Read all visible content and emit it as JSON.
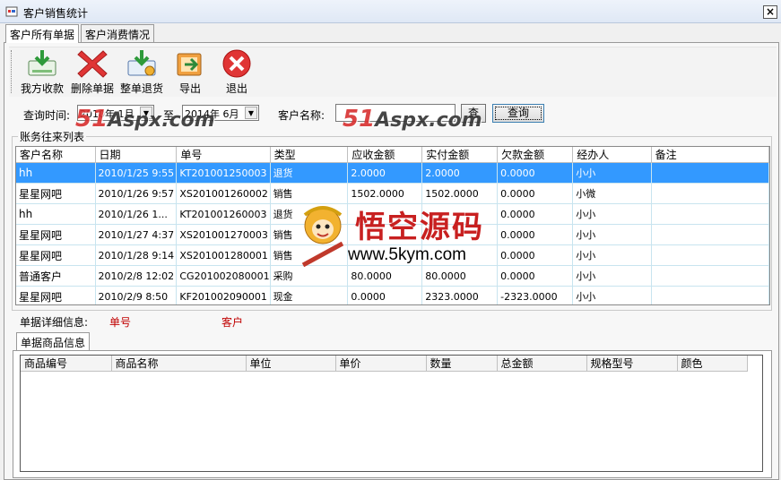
{
  "window": {
    "title": "客户销售统计",
    "close": "×"
  },
  "tabs": [
    "客户所有单据",
    "客户消费情况"
  ],
  "toolbar": {
    "buttons": [
      {
        "label": "我方收款",
        "icon": "money-receive-icon"
      },
      {
        "label": "删除单据",
        "icon": "delete-x-icon"
      },
      {
        "label": "整单退货",
        "icon": "return-goods-icon"
      },
      {
        "label": "导出",
        "icon": "export-icon"
      },
      {
        "label": "退出",
        "icon": "exit-icon"
      }
    ]
  },
  "query": {
    "time_label": "查询时间:",
    "from": "2010年 1月",
    "to_label": "至",
    "to": "2014年 6月",
    "customer_label": "客户名称:",
    "customer_value": "",
    "lookup_button": "查",
    "search_button": "查询"
  },
  "ledger": {
    "group_label": "账务往来列表",
    "columns": [
      "客户名称",
      "日期",
      "单号",
      "类型",
      "应收金额",
      "实付金额",
      "欠款金额",
      "经办人",
      "备注"
    ],
    "rows": [
      [
        "hh",
        "2010/1/25 9:55",
        "KT201001250003",
        "退货",
        "2.0000",
        "2.0000",
        "0.0000",
        "小小",
        ""
      ],
      [
        "星星网吧",
        "2010/1/26 9:57",
        "XS201001260002",
        "销售",
        "1502.0000",
        "1502.0000",
        "0.0000",
        "小微",
        ""
      ],
      [
        "hh",
        "2010/1/26 1...",
        "KT201001260003",
        "退货",
        "",
        "",
        "0.0000",
        "小小",
        ""
      ],
      [
        "星星网吧",
        "2010/1/27 4:37",
        "XS201001270003",
        "销售",
        "",
        "",
        "0.0000",
        "小小",
        ""
      ],
      [
        "星星网吧",
        "2010/1/28 9:14",
        "XS201001280001",
        "销售",
        "",
        "",
        "0.0000",
        "小小",
        ""
      ],
      [
        "普通客户",
        "2010/2/8 12:02",
        "CG201002080001",
        "采购",
        "80.0000",
        "80.0000",
        "0.0000",
        "小小",
        ""
      ],
      [
        "星星网吧",
        "2010/2/9 8:50",
        "KF201002090001",
        "现金",
        "0.0000",
        "2323.0000",
        "-2323.0000",
        "小小",
        ""
      ]
    ],
    "selected_row": 0
  },
  "detail": {
    "label": "单据详细信息:",
    "bill_no_label": "单号",
    "customer_label": "客户"
  },
  "goods": {
    "tab": "单据商品信息",
    "columns": [
      "商品编号",
      "商品名称",
      "单位",
      "单价",
      "数量",
      "总金额",
      "规格型号",
      "颜色"
    ]
  },
  "watermarks": {
    "aspx_left": "51",
    "aspx_mid": "Aspx",
    "aspx_right": ".com",
    "wukong_cn": "悟空源码",
    "wukong_url": "www.5kym.com"
  },
  "colors": {
    "selection": "#3399ff",
    "accent_red": "#c00000"
  }
}
